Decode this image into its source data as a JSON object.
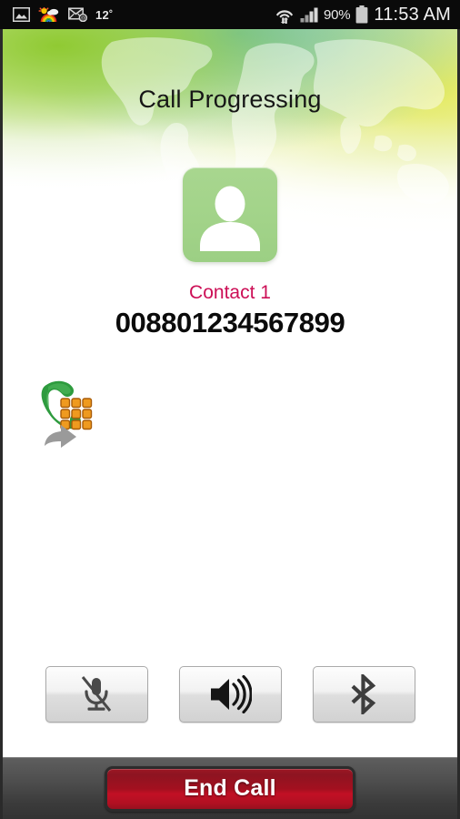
{
  "status_bar": {
    "icons_left": [
      {
        "name": "gallery-icon",
        "label": "Gallery"
      },
      {
        "name": "weather-rainbow-icon",
        "label": "Weather"
      },
      {
        "name": "email-icon",
        "label": "Email"
      }
    ],
    "temperature": "12˚",
    "wifi_icon": "wifi-data-transfer-icon",
    "signal_icon": "cellular-signal-icon",
    "battery_percent": "90%",
    "battery_icon": "battery-full-icon",
    "clock": "11:53 AM"
  },
  "header": {
    "title": "Call Progressing",
    "background": "world-map-gradient"
  },
  "contact": {
    "avatar_icon": "person-placeholder-icon",
    "name": "Contact 1",
    "number": "008801234567899",
    "name_color": "#cc0f56"
  },
  "dialpad": {
    "icon_name": "dialpad-forward-icon",
    "label": "Dialpad"
  },
  "controls": [
    {
      "name": "mute-button",
      "icon": "microphone-muted-icon",
      "label": "Mute"
    },
    {
      "name": "speaker-button",
      "icon": "speaker-icon",
      "label": "Speaker"
    },
    {
      "name": "bluetooth-button",
      "icon": "bluetooth-icon",
      "label": "Bluetooth"
    }
  ],
  "bottom": {
    "end_call_label": "End Call",
    "end_call_color": "#b21022"
  }
}
